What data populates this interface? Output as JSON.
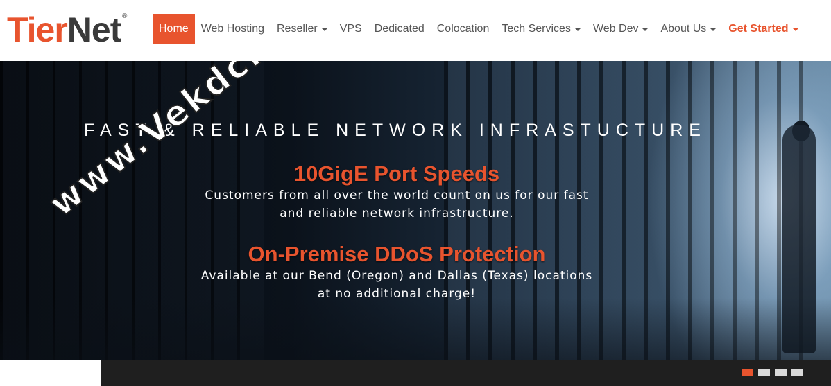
{
  "brand": {
    "logo_part1": "Tier",
    "logo_part2": "Net",
    "registered": "®",
    "accent_color": "#e8542e"
  },
  "nav": {
    "items": [
      {
        "label": "Home",
        "active": true,
        "dropdown": false
      },
      {
        "label": "Web Hosting",
        "active": false,
        "dropdown": false
      },
      {
        "label": "Reseller",
        "active": false,
        "dropdown": true
      },
      {
        "label": "VPS",
        "active": false,
        "dropdown": false
      },
      {
        "label": "Dedicated",
        "active": false,
        "dropdown": false
      },
      {
        "label": "Colocation",
        "active": false,
        "dropdown": false
      },
      {
        "label": "Tech Services",
        "active": false,
        "dropdown": true
      },
      {
        "label": "Web Dev",
        "active": false,
        "dropdown": true
      },
      {
        "label": "About Us",
        "active": false,
        "dropdown": true
      },
      {
        "label": "Get Started",
        "active": false,
        "dropdown": true
      }
    ]
  },
  "hero": {
    "tagline": "FAST & RELIABLE NETWORK INFRASTUCTURE",
    "feature1_title": "10GigE Port Speeds",
    "feature1_line1": "Customers from all over the world count on us for our fast",
    "feature1_line2": "and reliable network infrastructure.",
    "feature2_title": "On-Premise DDoS Protection",
    "feature2_line1": "Available at our Bend (Oregon) and Dallas (Texas) locations",
    "feature2_line2": "at no additional charge!"
  },
  "watermark": "www.Vekdc.com",
  "slider": {
    "slide_count": 4,
    "active_index": 0
  }
}
